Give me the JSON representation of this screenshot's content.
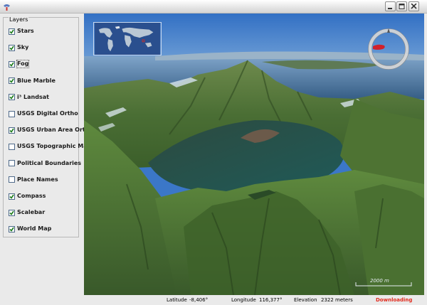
{
  "window": {
    "minimize_icon": "minimize-icon",
    "maximize_icon": "maximize-icon",
    "close_icon": "close-icon"
  },
  "layers": {
    "title": "Layers",
    "items": [
      {
        "label": "Stars",
        "checked": true
      },
      {
        "label": "Sky",
        "checked": true
      },
      {
        "label": "Fog",
        "checked": true
      },
      {
        "label": "Blue Marble",
        "checked": true
      },
      {
        "label": "i³ Landsat",
        "checked": true
      },
      {
        "label": "USGS Digital Ortho",
        "checked": false
      },
      {
        "label": "USGS Urban Area Ortho",
        "checked": true
      },
      {
        "label": "USGS Topographic Maps",
        "checked": false
      },
      {
        "label": "Political Boundaries",
        "checked": false
      },
      {
        "label": "Place Names",
        "checked": false
      },
      {
        "label": "Compass",
        "checked": true
      },
      {
        "label": "Scalebar",
        "checked": true
      },
      {
        "label": "World Map",
        "checked": true
      }
    ]
  },
  "viewport": {
    "scalebar_label": "2000 m",
    "compass_icon": "compass-icon",
    "world_map_icon": "world-map-icon"
  },
  "status": {
    "latitude_label": "Latitude",
    "latitude_value": "-8,406°",
    "longitude_label": "Longitude",
    "longitude_value": "116,377°",
    "elevation_label": "Elevation",
    "elevation_value": "2322 meters",
    "downloading": "Downloading"
  },
  "colors": {
    "sky": "#3b77c8",
    "terrain": "#4f7a3a",
    "lake": "#2e4f3e",
    "accent": "#e22b1e"
  }
}
